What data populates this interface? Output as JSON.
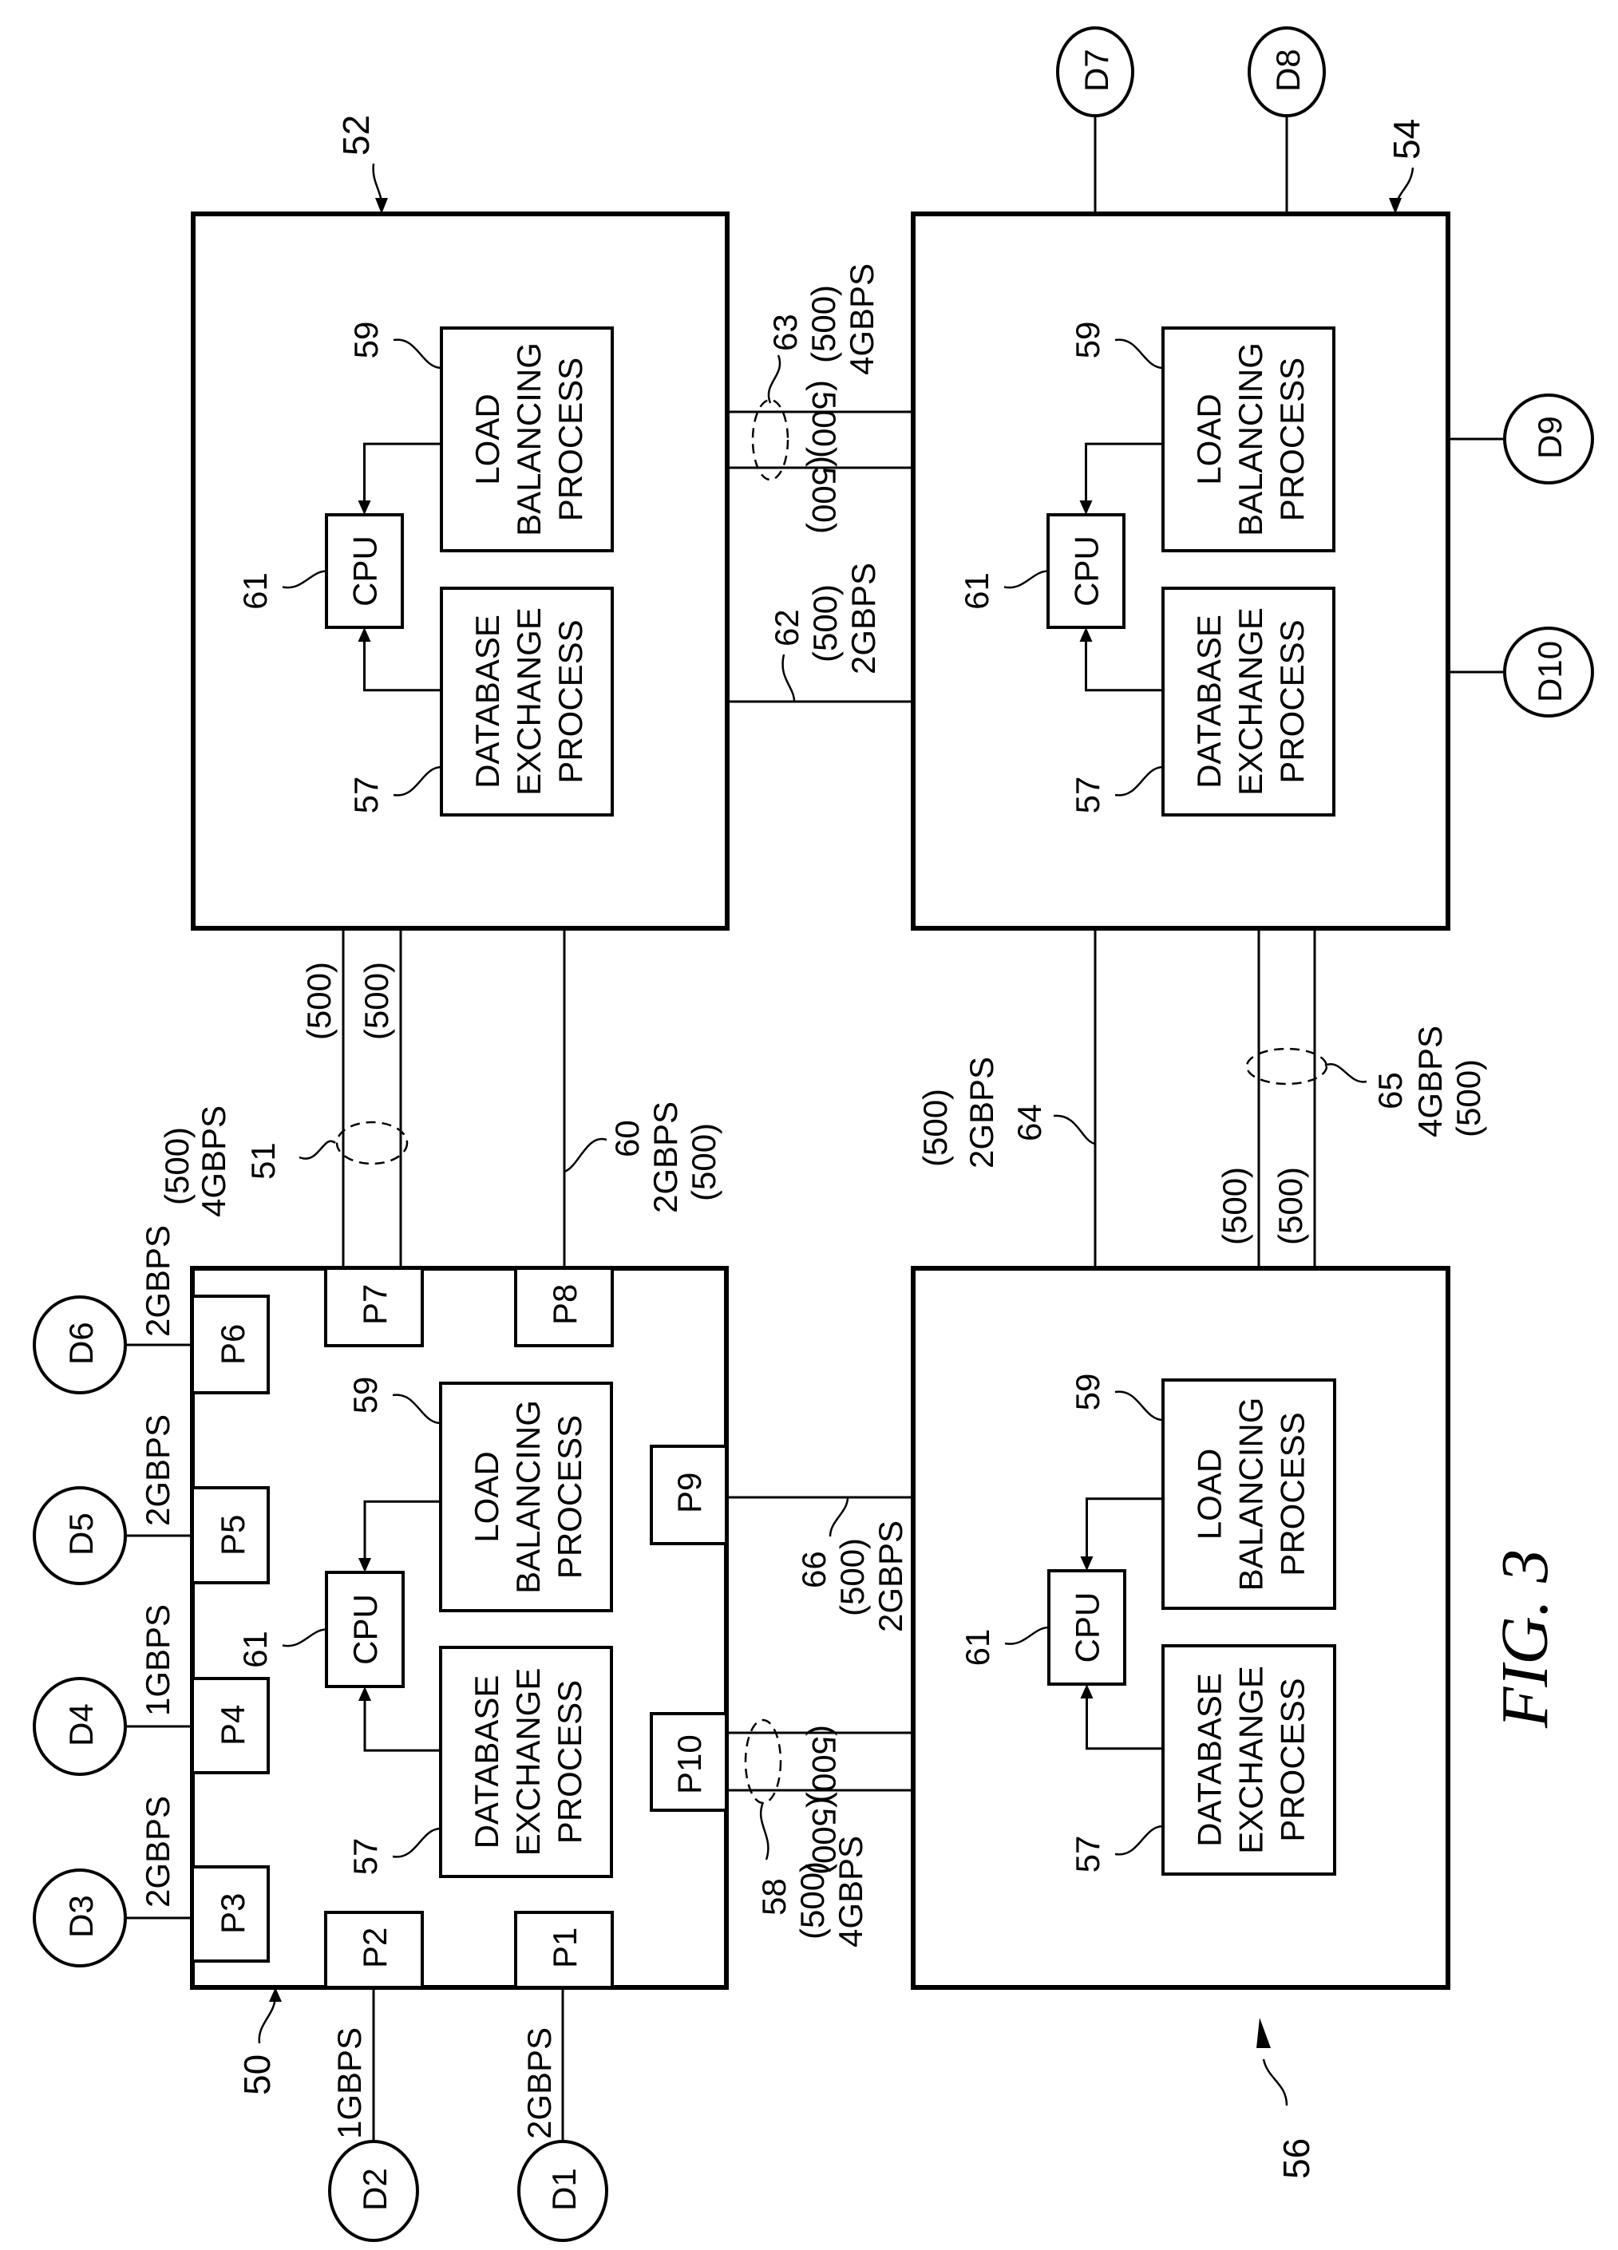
{
  "figure": {
    "caption": "FIG. 3",
    "orientation": "rotated 90° counter-clockwise"
  },
  "nodes": [
    {
      "id": "50",
      "ref": "50",
      "has_ports": true
    },
    {
      "id": "52",
      "ref": "52"
    },
    {
      "id": "54",
      "ref": "54"
    },
    {
      "id": "56",
      "ref": "56"
    }
  ],
  "node_internals": {
    "cpu": {
      "label": "CPU",
      "ref": "61"
    },
    "load_balancing": {
      "lines": [
        "LOAD",
        "BALANCING",
        "PROCESS"
      ],
      "ref": "59"
    },
    "database_exchange": {
      "lines": [
        "DATABASE",
        "EXCHANGE",
        "PROCESS"
      ],
      "ref": "57"
    }
  },
  "ports": [
    "P1",
    "P2",
    "P3",
    "P4",
    "P5",
    "P6",
    "P7",
    "P8",
    "P9",
    "P10"
  ],
  "disks": {
    "D1": {
      "label": "D1",
      "port": "P1",
      "speed": "2GBPS"
    },
    "D2": {
      "label": "D2",
      "port": "P2",
      "speed": "1GBPS"
    },
    "D3": {
      "label": "D3",
      "port": "P3",
      "speed": "2GBPS"
    },
    "D4": {
      "label": "D4",
      "port": "P4",
      "speed": "1GBPS"
    },
    "D5": {
      "label": "D5",
      "port": "P5",
      "speed": "2GBPS"
    },
    "D6": {
      "label": "D6",
      "port": "P6",
      "speed": "2GBPS"
    },
    "D7": {
      "label": "D7",
      "node": "54"
    },
    "D8": {
      "label": "D8",
      "node": "54"
    },
    "D9": {
      "label": "D9",
      "node": "54"
    },
    "D10": {
      "label": "D10",
      "node": "54"
    }
  },
  "links": {
    "l51": {
      "ref": "51",
      "speed": "4GBPS",
      "capacity": "(500)",
      "members": [
        "(500)",
        "(500)"
      ],
      "between": [
        "50:P7",
        "52"
      ]
    },
    "l60": {
      "ref": "60",
      "speed": "2GBPS",
      "capacity": "(500)",
      "between": [
        "50:P8",
        "52"
      ]
    },
    "l62": {
      "ref": "62",
      "speed": "2GBPS",
      "capacity": "(500)",
      "between": [
        "52",
        "54"
      ]
    },
    "l63": {
      "ref": "63",
      "speed": "4GBPS",
      "capacity": "(500)",
      "members": [
        "(500)",
        "(500)"
      ],
      "between": [
        "52",
        "54"
      ]
    },
    "l64": {
      "ref": "64",
      "speed": "2GBPS",
      "capacity": "(500)",
      "between": [
        "56",
        "54"
      ]
    },
    "l65": {
      "ref": "65",
      "speed": "4GBPS",
      "capacity": "(500)",
      "members": [
        "(500)",
        "(500)"
      ],
      "between": [
        "56",
        "54"
      ]
    },
    "l66": {
      "ref": "66",
      "speed": "2GBPS",
      "capacity": "(500)",
      "between": [
        "50:P9",
        "56"
      ]
    },
    "l58": {
      "ref": "58",
      "speed": "4GBPS",
      "capacity": "(500)",
      "members": [
        "(500)",
        "(500)"
      ],
      "between": [
        "50:P10",
        "56"
      ]
    }
  }
}
